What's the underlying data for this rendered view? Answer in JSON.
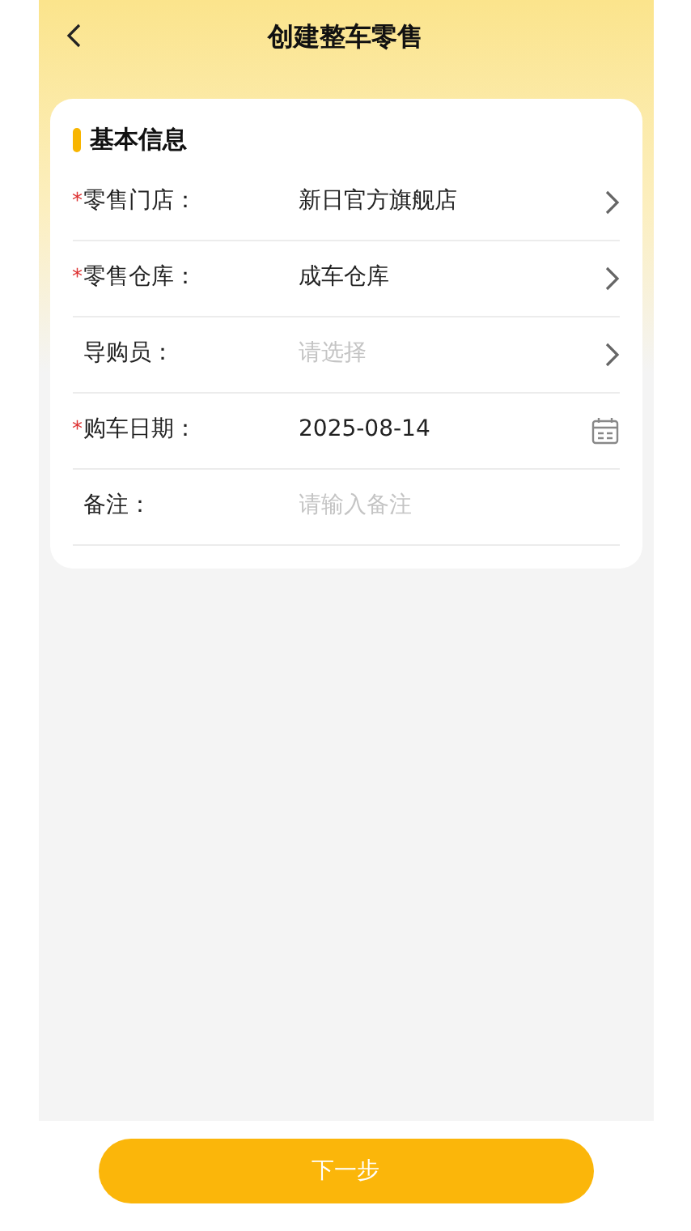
{
  "header": {
    "title": "创建整车零售"
  },
  "section": {
    "title": "基本信息"
  },
  "fields": [
    {
      "kind": "select",
      "required_mark": "*",
      "label": "零售门店：",
      "value": "新日官方旗舰店"
    },
    {
      "kind": "select",
      "required_mark": "*",
      "label": "零售仓库：",
      "value": "成车仓库"
    },
    {
      "kind": "select",
      "label": "导购员：",
      "placeholder": "请选择"
    },
    {
      "kind": "date",
      "required_mark": "*",
      "label": "购车日期：",
      "value": "2025-08-14"
    },
    {
      "kind": "input",
      "label": "备注：",
      "placeholder": "请输入备注"
    }
  ],
  "next_button": {
    "label": "下一步"
  }
}
